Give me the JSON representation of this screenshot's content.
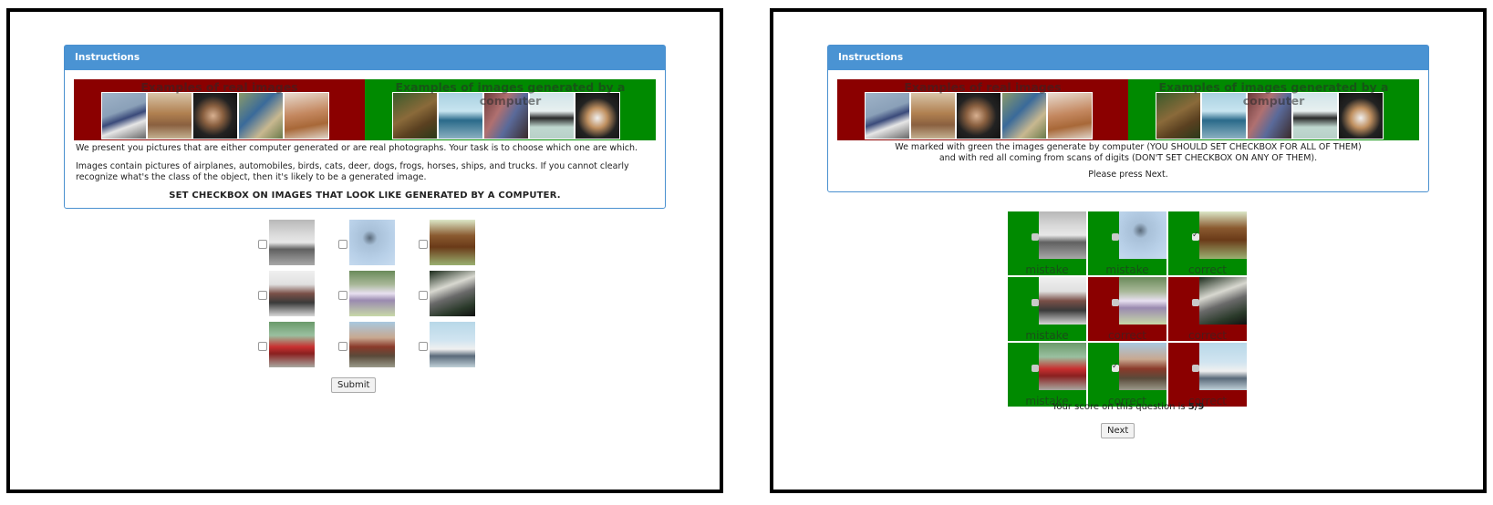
{
  "left": {
    "header": "Instructions",
    "real_label": "Examples of real images",
    "gen_label": "Examples of images generated by a computer",
    "p1": "We present you pictures that are either computer generated or are real photographs. Your task is to choose which one are which.",
    "p2": "Images contain pictures of airplanes, automobiles, birds, cats, deer, dogs, frogs, horses, ships, and trucks. If you cannot clearly recognize what's the class of the object, then it's likely to be a generated image.",
    "p3": "SET CHECKBOX ON IMAGES THAT LOOK LIKE GENERATED BY A COMPUTER.",
    "submit": "Submit"
  },
  "right": {
    "header": "Instructions",
    "real_label": "Examples of real images",
    "gen_label": "Examples of images generated by a computer",
    "line1": "We marked with green the images generate by computer (YOU SHOULD SET CHECKBOX FOR ALL OF THEM)",
    "line2": "and with red all coming from scans of digits (DON'T SET CHECKBOX ON ANY OF THEM).",
    "line3": "Please press Next.",
    "results": [
      {
        "label": "mistake",
        "color": "green",
        "checked": false
      },
      {
        "label": "mistake",
        "color": "green",
        "checked": false
      },
      {
        "label": "correct",
        "color": "green",
        "checked": true
      },
      {
        "label": "mistake",
        "color": "green",
        "checked": false
      },
      {
        "label": "correct",
        "color": "red",
        "checked": false
      },
      {
        "label": "correct",
        "color": "red",
        "checked": false
      },
      {
        "label": "mistake",
        "color": "green",
        "checked": false
      },
      {
        "label": "correct",
        "color": "green",
        "checked": true
      },
      {
        "label": "correct",
        "color": "red",
        "checked": false
      }
    ],
    "score_prefix": "Your score on this question is ",
    "score_value": "5/9",
    "next": "Next"
  },
  "colors": {
    "header": "#4a93d3",
    "real": "#8b0000",
    "generated": "#008a00"
  }
}
